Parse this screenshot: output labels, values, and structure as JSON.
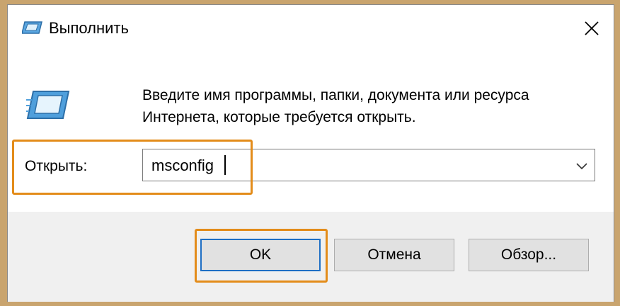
{
  "window": {
    "title": "Выполнить",
    "close_icon": "close-icon"
  },
  "prompt": {
    "line1": "Введите имя программы, папки, документа или ресурса",
    "line2": "Интернета, которые требуется открыть."
  },
  "open": {
    "label": "Открыть:",
    "value": "msconfig"
  },
  "buttons": {
    "ok": "OK",
    "cancel": "Отмена",
    "browse": "Обзор..."
  },
  "colors": {
    "highlight": "#e38c1a",
    "focus": "#1f6fc4",
    "icon": "#3a8fd4"
  }
}
